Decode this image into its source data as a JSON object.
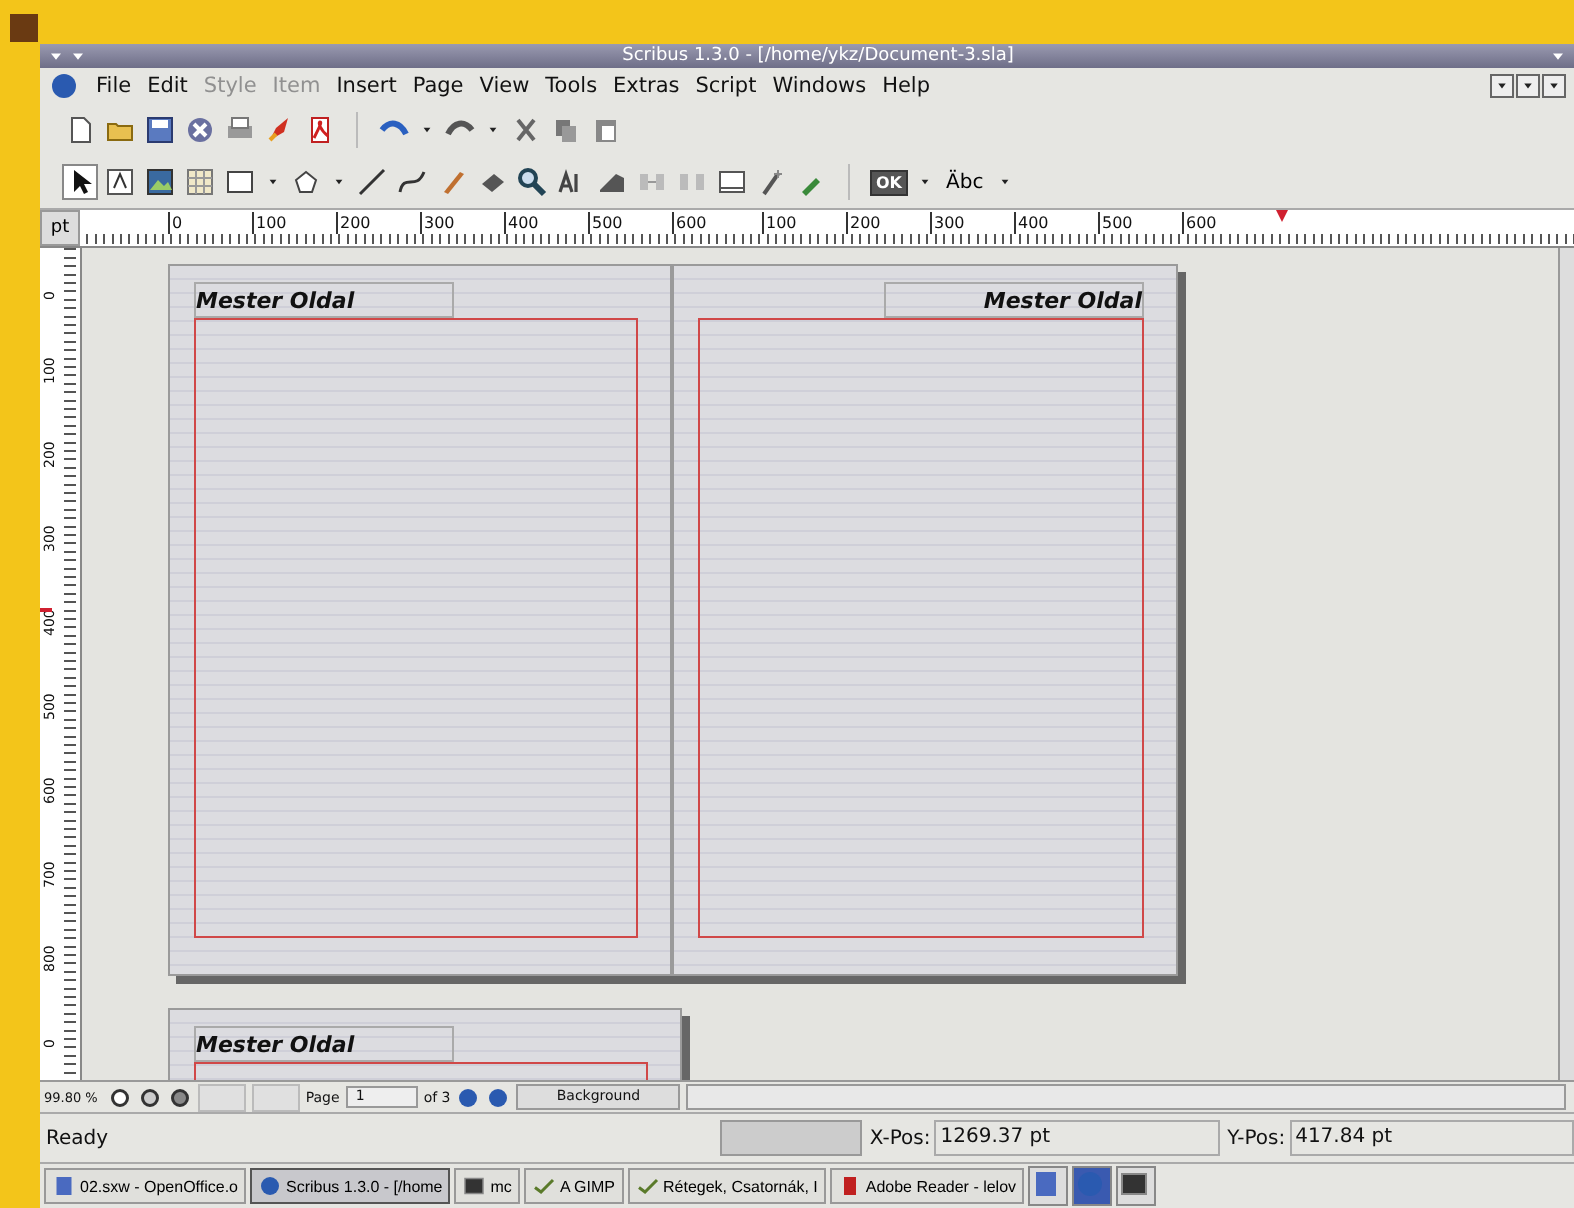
{
  "window": {
    "title": "Scribus 1.3.0 - [/home/ykz/Document-3.sla]"
  },
  "menu": [
    {
      "label": "File",
      "disabled": false
    },
    {
      "label": "Edit",
      "disabled": false
    },
    {
      "label": "Style",
      "disabled": true
    },
    {
      "label": "Item",
      "disabled": true
    },
    {
      "label": "Insert",
      "disabled": false
    },
    {
      "label": "Page",
      "disabled": false
    },
    {
      "label": "View",
      "disabled": false
    },
    {
      "label": "Tools",
      "disabled": false
    },
    {
      "label": "Extras",
      "disabled": false
    },
    {
      "label": "Script",
      "disabled": false
    },
    {
      "label": "Windows",
      "disabled": false
    },
    {
      "label": "Help",
      "disabled": false
    }
  ],
  "toolbar": {
    "pdf_ok_label": "OK",
    "spellcheck_label": "Äbc"
  },
  "rulers": {
    "unit": "pt",
    "horizontal_labels": [
      "0",
      "100",
      "200",
      "300",
      "400",
      "500",
      "600",
      "100",
      "200",
      "300",
      "400",
      "500",
      "600"
    ],
    "vertical_labels": [
      "0",
      "100",
      "200",
      "300",
      "400",
      "500",
      "600",
      "700",
      "800",
      "0"
    ]
  },
  "pages": [
    {
      "label": "Mester Oldal",
      "kind": "left"
    },
    {
      "label": "Mester Oldal",
      "kind": "right"
    },
    {
      "label": "Mester Oldal",
      "kind": "left"
    }
  ],
  "navigation": {
    "zoom": "99.80 %",
    "page_label": "Page",
    "page": "1",
    "page_count": "of 3",
    "layer": "Background"
  },
  "status_bar": {
    "message": "Ready",
    "x_label": "X-Pos:",
    "x_value": "1269.37 pt",
    "y_label": "Y-Pos:",
    "y_value": "417.84 pt"
  },
  "taskbar": [
    {
      "label": "02.sxw - OpenOffice.o",
      "selected": false
    },
    {
      "label": "Scribus 1.3.0 - [/home",
      "selected": true
    },
    {
      "label": "mc",
      "selected": false
    },
    {
      "label": "A GIMP",
      "selected": false
    },
    {
      "label": "Rétegek, Csatornák, I",
      "selected": false
    },
    {
      "label": "Adobe Reader - lelov",
      "selected": false
    }
  ]
}
